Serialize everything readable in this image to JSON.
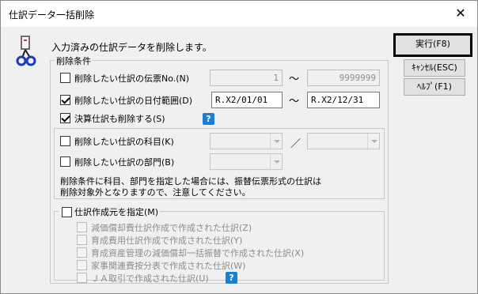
{
  "window": {
    "title": "仕訳データ一括削除",
    "close_symbol": "✕"
  },
  "description": "入力済みの仕訳データを削除します。",
  "conditions": {
    "legend": "削除条件",
    "voucher": {
      "label": "削除したい仕訳の伝票No.(N)",
      "checked": false,
      "from": "1",
      "to": "9999999"
    },
    "date": {
      "label": "削除したい仕訳の日付範囲(D)",
      "checked": true,
      "from": "R.X2/01/01",
      "to": "R.X2/12/31"
    },
    "range_sep": "〜",
    "settlement": {
      "label": "決算仕訳も削除する(S)",
      "checked": true
    },
    "help_symbol": "?",
    "account": {
      "label": "削除したい仕訳の科目(K)",
      "checked": false,
      "sep": "／"
    },
    "department": {
      "label": "削除したい仕訳の部門(B)",
      "checked": false
    },
    "note_line1": "削除条件に科目、部門を指定した場合には、振替伝票形式の仕訳は",
    "note_line2": "削除対象外となりますので、注意してください。",
    "origin": {
      "label": "仕訳作成元を指定(M)",
      "checked": false,
      "items": [
        "減価償却費仕訳作成で作成された仕訳(Z)",
        "育成費用仕訳作成で作成された仕訳(Y)",
        "育成資産管理の減価償却一括振替で作成された仕訳(X)",
        "家事関連費按分表で作成された仕訳(W)",
        "ＪＡ取引で作成された仕訳(U)"
      ]
    }
  },
  "buttons": {
    "execute": "実行(F8)",
    "cancel": "ｷｬﾝｾﾙ(ESC)",
    "help": "ﾍﾙﾌﾟ(F1)"
  }
}
